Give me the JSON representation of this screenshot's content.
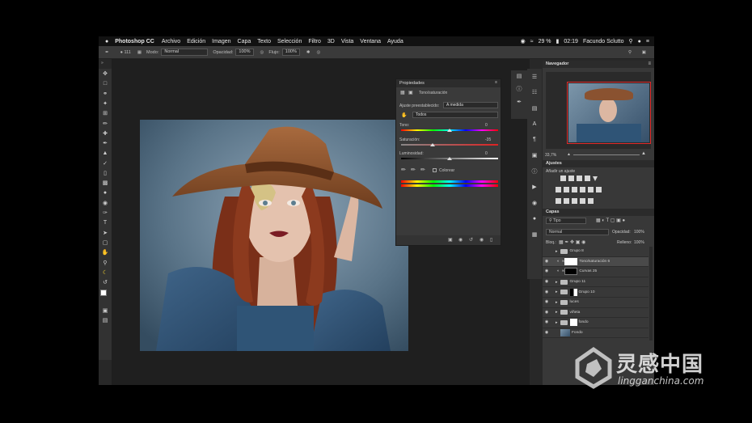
{
  "menu": {
    "app": "Photoshop CC",
    "items": [
      "Archivo",
      "Edición",
      "Imagen",
      "Capa",
      "Texto",
      "Selección",
      "Filtro",
      "3D",
      "Vista",
      "Ventana",
      "Ayuda"
    ],
    "battery": "29 %",
    "time": "02:19",
    "user": "Facundo Sclutto"
  },
  "options": {
    "mode_label": "Modo:",
    "mode_value": "Normal",
    "opacity_label": "Opacidad:",
    "opacity_value": "100%",
    "flow_label": "Flujo:",
    "flow_value": "100%",
    "brush_size": "111"
  },
  "properties": {
    "title": "Propiedades",
    "subtitle": "Tono/saturación",
    "preset_label": "Ajuste preestablecido:",
    "preset_value": "A medida",
    "channel_value": "Todos",
    "hue_label": "Tono:",
    "hue_value": "0",
    "sat_label": "Saturación:",
    "sat_value": "-35",
    "light_label": "Luminosidad:",
    "light_value": "0",
    "colorize_label": "Colorear"
  },
  "navigator": {
    "title": "Navegador",
    "zoom": "33,7%"
  },
  "adjustments": {
    "title": "Ajustes",
    "add_label": "Añadir un ajuste"
  },
  "layers": {
    "title": "Capas",
    "filter_value": "Tipo",
    "blend_value": "Normal",
    "opacity_label": "Opacidad:",
    "opacity_value": "100%",
    "lock_label": "Bloq.:",
    "fill_label": "Relleno:",
    "fill_value": "100%",
    "items": [
      {
        "name": "Grupo 8"
      },
      {
        "name": "Tono/saturación 6"
      },
      {
        "name": "Curvas 25"
      },
      {
        "name": "Grupo 11"
      },
      {
        "name": "Grupo 10"
      },
      {
        "name": "luces"
      },
      {
        "name": "viñeta"
      },
      {
        "name": "fondo"
      },
      {
        "name": "Fondo"
      }
    ]
  },
  "watermark": {
    "cn": "灵感中国",
    "url": "lingganchina.com"
  }
}
